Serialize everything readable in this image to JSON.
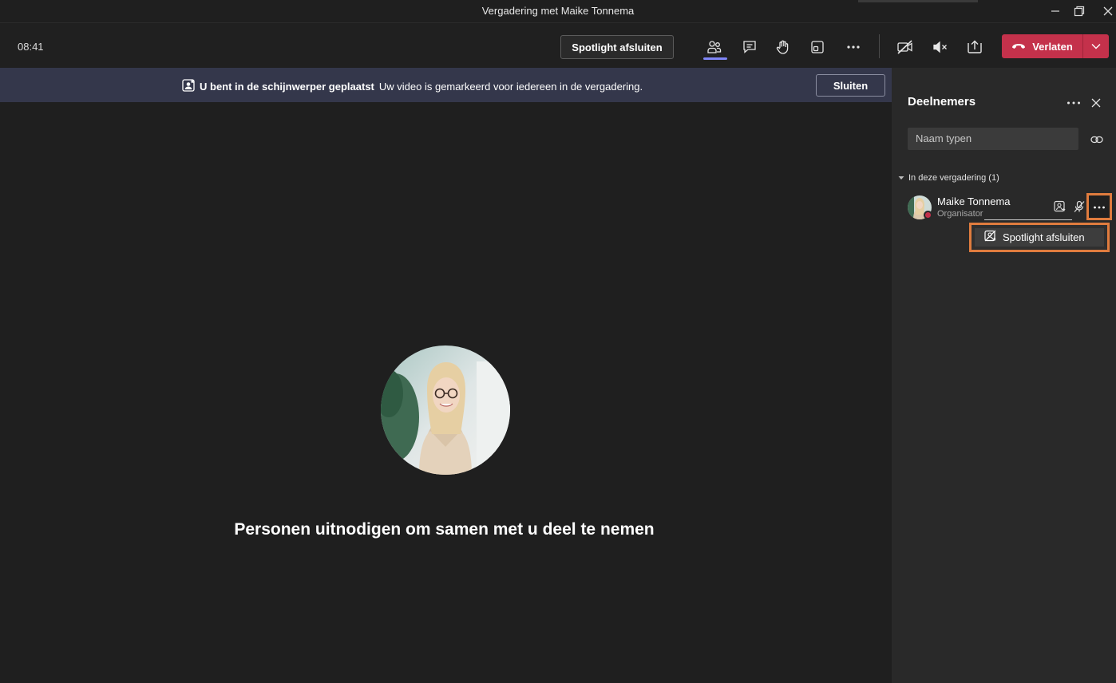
{
  "window": {
    "title": "Vergadering met Maike Tonnema"
  },
  "toolbar": {
    "time": "08:41",
    "spotlight_button": "Spotlight afsluiten",
    "leave_label": "Verlaten",
    "icons": [
      "people-icon",
      "chat-icon",
      "raise-hand-icon",
      "rooms-icon",
      "more-icon",
      "camera-off-icon",
      "speaker-mute-icon",
      "share-tray-icon",
      "phone-hangup-icon",
      "chevron-down-icon"
    ]
  },
  "banner": {
    "title": "U bent in de schijnwerper geplaatst",
    "text": "Uw video is gemarkeerd voor iedereen in de vergadering.",
    "close_label": "Sluiten"
  },
  "stage": {
    "invite_text": "Personen uitnodigen om samen met u deel te nemen"
  },
  "panel": {
    "title": "Deelnemers",
    "search_placeholder": "Naam typen",
    "section_label": "In deze vergadering (1)",
    "participant": {
      "name": "Maike Tonnema",
      "role": "Organisator"
    },
    "context_menu": {
      "item_label": "Spotlight afsluiten"
    }
  },
  "colors": {
    "accent": "#7f85f5",
    "leave": "#c4314b",
    "highlight": "#e07c3e",
    "banner": "#34374b"
  }
}
